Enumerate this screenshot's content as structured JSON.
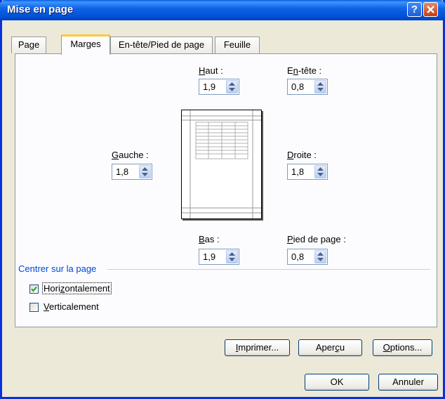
{
  "window": {
    "title": "Mise en page"
  },
  "titlebar": {
    "help_glyph": "?"
  },
  "tabs": [
    {
      "label": "Page"
    },
    {
      "label": "Marges"
    },
    {
      "label": "En-tête/Pied de page"
    },
    {
      "label": "Feuille"
    }
  ],
  "margins": {
    "haut": {
      "label_pre": "",
      "label_u": "H",
      "label_post": "aut :",
      "value": "1,9"
    },
    "entete": {
      "label_pre": "E",
      "label_u": "n",
      "label_post": "-tête :",
      "value": "0,8"
    },
    "gauche": {
      "label_pre": "",
      "label_u": "G",
      "label_post": "auche :",
      "value": "1,8"
    },
    "droite": {
      "label_pre": "",
      "label_u": "D",
      "label_post": "roite :",
      "value": "1,8"
    },
    "bas": {
      "label_pre": "",
      "label_u": "B",
      "label_post": "as :",
      "value": "1,9"
    },
    "pied": {
      "label_pre": "",
      "label_u": "P",
      "label_post": "ied de page :",
      "value": "0,8"
    }
  },
  "center": {
    "group_title": "Centrer sur la page",
    "horizontal": {
      "label_pre": "Hori",
      "label_u": "z",
      "label_post": "ontalement",
      "checked": true
    },
    "vertical": {
      "label_pre": "",
      "label_u": "V",
      "label_post": "erticalement",
      "checked": false
    }
  },
  "buttons": {
    "imprimer": {
      "pre": "",
      "u": "I",
      "post": "mprimer..."
    },
    "apercu": {
      "pre": "Aper",
      "u": "ç",
      "post": "u"
    },
    "options": {
      "pre": "",
      "u": "O",
      "post": "ptions..."
    },
    "ok": "OK",
    "annuler": "Annuler"
  },
  "colors": {
    "titlebar": "#0055e5",
    "group_title": "#0046d5",
    "active_tab_accent": "#ffc83c"
  }
}
